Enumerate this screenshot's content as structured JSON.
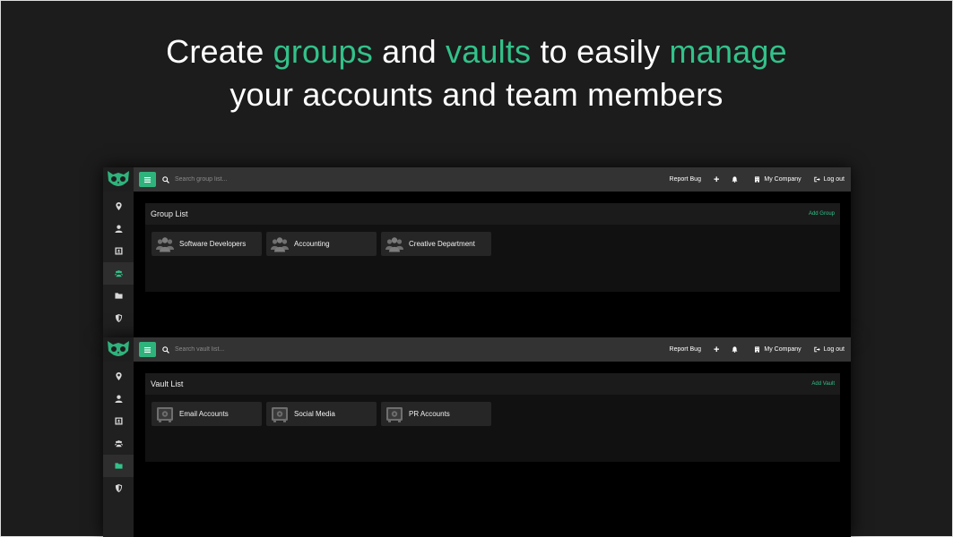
{
  "headline": {
    "part1": "Create ",
    "accent1": "groups",
    "part2": " and ",
    "accent2": "vaults",
    "part3": " to easily ",
    "accent3": "manage",
    "line2": "your accounts and team members"
  },
  "colors": {
    "accent": "#32c28a",
    "background": "#1c1c1c",
    "topbar": "#333333"
  },
  "sidebar": {
    "items": [
      {
        "icon": "location-pin-icon"
      },
      {
        "icon": "user-icon"
      },
      {
        "icon": "id-card-icon"
      },
      {
        "icon": "users-icon"
      },
      {
        "icon": "folder-icon"
      },
      {
        "icon": "shield-icon"
      }
    ]
  },
  "topbar": {
    "report_bug": "Report Bug",
    "add": "+",
    "company": "My Company",
    "logout": "Log out"
  },
  "groups_screen": {
    "search_placeholder": "Search group list...",
    "panel_title": "Group List",
    "panel_action": "Add Group",
    "active_item": 3,
    "cards": [
      {
        "label": "Software Developers",
        "icon": "group-icon"
      },
      {
        "label": "Accounting",
        "icon": "group-icon"
      },
      {
        "label": "Creative Department",
        "icon": "group-icon"
      }
    ]
  },
  "vaults_screen": {
    "search_placeholder": "Search vault list...",
    "panel_title": "Vault List",
    "panel_action": "Add Vault",
    "active_item": 4,
    "cards": [
      {
        "label": "Email Accounts",
        "icon": "vault-icon"
      },
      {
        "label": "Social Media",
        "icon": "vault-icon"
      },
      {
        "label": "PR Accounts",
        "icon": "vault-icon"
      }
    ]
  }
}
